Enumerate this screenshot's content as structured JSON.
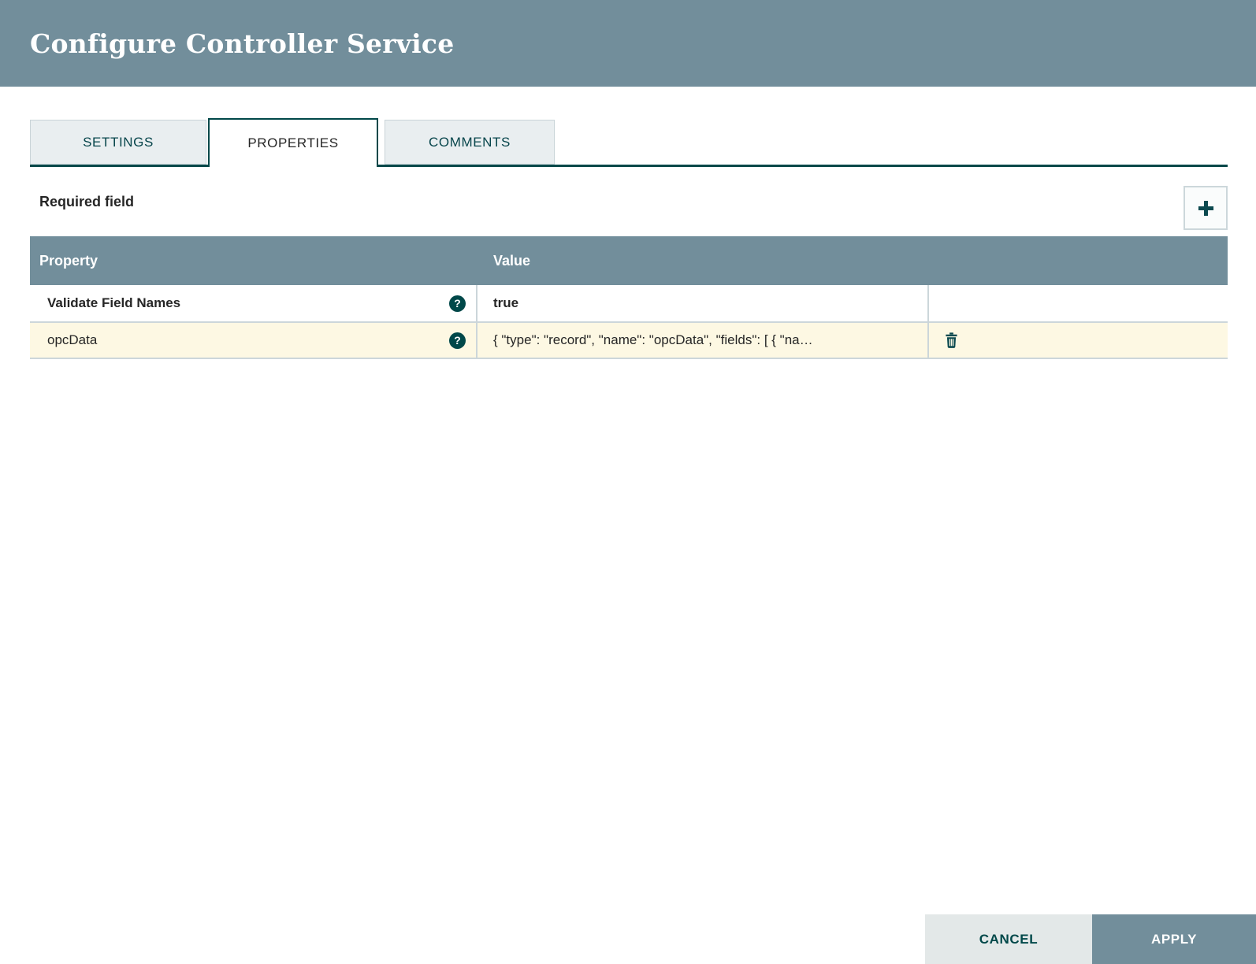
{
  "dialog": {
    "title": "Configure Controller Service"
  },
  "tabs": [
    {
      "label": "SETTINGS",
      "active": false
    },
    {
      "label": "PROPERTIES",
      "active": true
    },
    {
      "label": "COMMENTS",
      "active": false
    }
  ],
  "properties_panel": {
    "required_label": "Required field",
    "add_button_icon": "plus-icon",
    "table": {
      "columns": [
        "Property",
        "Value"
      ],
      "rows": [
        {
          "property": "Validate Field Names",
          "value": "true",
          "help_icon": "question-circle-icon",
          "highlighted": false,
          "deletable": false
        },
        {
          "property": "opcData",
          "value": "{ \"type\": \"record\", \"name\": \"opcData\", \"fields\": [ { \"na…",
          "help_icon": "question-circle-icon",
          "highlighted": true,
          "deletable": true,
          "delete_icon": "trash-icon"
        }
      ]
    }
  },
  "footer": {
    "cancel_label": "CANCEL",
    "apply_label": "APPLY"
  },
  "colors": {
    "header_bg": "#728e9b",
    "accent_teal": "#004849",
    "inactive_tab_bg": "#e9eef0",
    "row_highlight_bg": "#fdf8e3",
    "row_border": "#ccd6da",
    "cancel_bg": "#e3e8e8",
    "apply_bg": "#728e9b"
  }
}
